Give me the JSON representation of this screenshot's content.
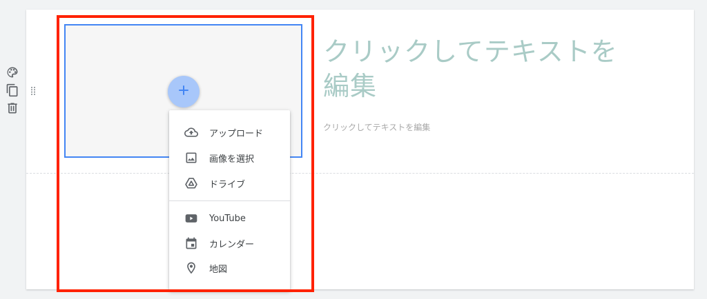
{
  "side_tools": [
    {
      "icon": "palette-icon"
    },
    {
      "icon": "copy-icon"
    },
    {
      "icon": "trash-icon"
    }
  ],
  "text_block": {
    "title": "クリックしてテキストを編集",
    "body": "クリックしてテキストを編集"
  },
  "image_block": {
    "add_icon": "plus-icon",
    "menu": {
      "items": [
        {
          "label": "アップロード",
          "icon": "cloud-upload-icon"
        },
        {
          "label": "画像を選択",
          "icon": "image-icon"
        },
        {
          "label": "ドライブ",
          "icon": "drive-icon"
        },
        {
          "label": "YouTube",
          "icon": "youtube-icon"
        },
        {
          "label": "カレンダー",
          "icon": "calendar-icon"
        },
        {
          "label": "地図",
          "icon": "map-pin-icon"
        }
      ]
    }
  },
  "colors": {
    "accent_blue": "#4285f4",
    "fab_blue": "#a8c7fa",
    "highlight_red": "#ff2200",
    "title_teal": "#a9cbc6",
    "icon_gray": "#5f6368"
  }
}
